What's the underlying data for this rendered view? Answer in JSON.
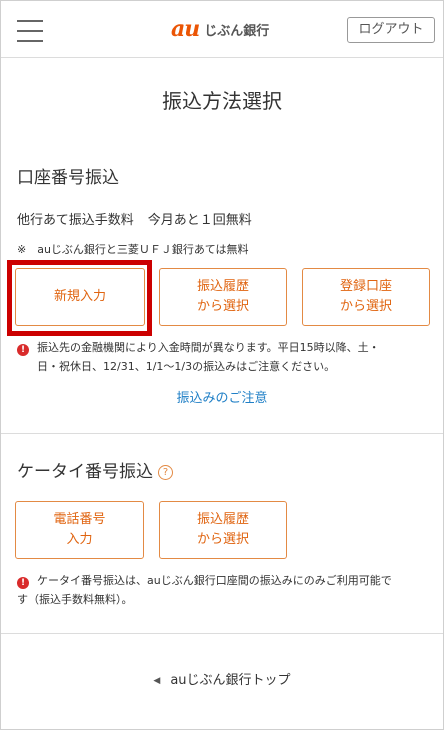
{
  "header": {
    "logo_au": "au",
    "logo_bank": "じぶん銀行",
    "logout_label": "ログアウト",
    "menu_icon": "hamburger-menu-icon",
    "brand_color": "#eb5505"
  },
  "page": {
    "title": "振込方法選択"
  },
  "account_section": {
    "title": "口座番号振込",
    "fee_label": "他行あて振込手数料",
    "fee_count": "今月あと１回無料",
    "free_note": "※　auじぶん銀行と三菱ＵＦＪ銀行あては無料",
    "buttons": {
      "new_input": "新規入力",
      "history_line1": "振込履歴",
      "history_line2": "から選択",
      "registered_line1": "登録口座",
      "registered_line2": "から選択"
    },
    "notice_line1": "振込先の金融機関により入金時間が異なります。平日15時以降、土・",
    "notice_line2": "日・祝休日、12/31、1/1～1/3の振込みはご注意ください。",
    "caution_link": "振込みのご注意"
  },
  "phone_section": {
    "title": "ケータイ番号振込",
    "help_icon": "question-circle-icon",
    "buttons": {
      "phone_line1": "電話番号",
      "phone_line2": "入力",
      "history_line1": "振込履歴",
      "history_line2": "から選択"
    },
    "notice_line1": "ケータイ番号振込は、auじぶん銀行口座間の振込みにのみご利用可能で",
    "notice_line2": "す（振込手数料無料）。"
  },
  "footer": {
    "top_link": "auじぶん銀行トップ"
  },
  "colors": {
    "accent": "#e06410",
    "button_border": "#e38a44",
    "link": "#1f7fc6",
    "alert": "#d92b2b",
    "highlight": "#cc0000"
  }
}
